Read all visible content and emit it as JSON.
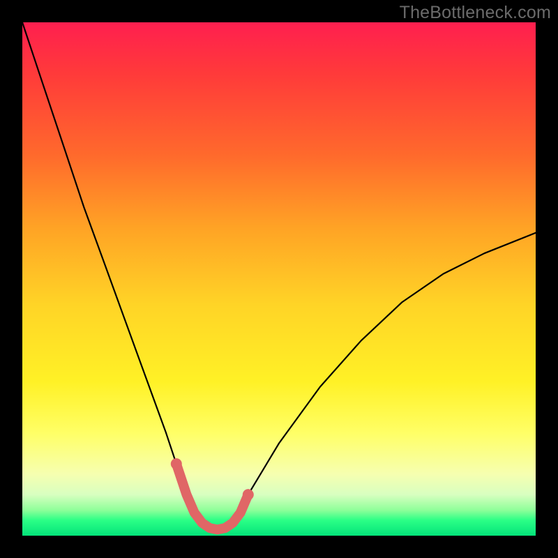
{
  "watermark": "TheBottleneck.com",
  "chart_data": {
    "type": "line",
    "title": "",
    "xlabel": "",
    "ylabel": "",
    "xlim": [
      0,
      100
    ],
    "ylim": [
      0,
      100
    ],
    "x": [
      0,
      4,
      8,
      12,
      16,
      20,
      24,
      28,
      30,
      32,
      33.5,
      35,
      36.5,
      38,
      39.5,
      41,
      42.5,
      44,
      50,
      58,
      66,
      74,
      82,
      90,
      100
    ],
    "values": [
      100,
      88,
      76,
      64,
      53,
      42,
      31,
      20,
      14,
      8,
      4.5,
      2.5,
      1.5,
      1.2,
      1.5,
      2.5,
      4.5,
      8,
      18,
      29,
      38,
      45.5,
      51,
      55,
      59
    ],
    "highlight_x_range": [
      30,
      44
    ],
    "highlight_stroke": "#e06666",
    "curve_stroke": "#000000"
  }
}
